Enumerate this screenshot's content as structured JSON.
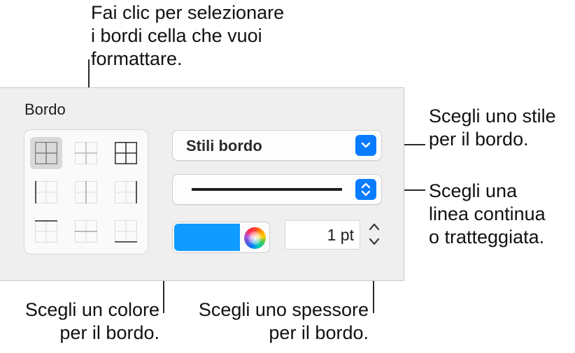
{
  "callouts": {
    "select_borders": [
      "Fai clic per selezionare",
      "i bordi cella che vuoi",
      "formattare."
    ],
    "border_style": [
      "Scegli uno stile",
      "per il bordo."
    ],
    "line_type": [
      "Scegli una",
      "linea continua",
      "o tratteggiata."
    ],
    "color": [
      "Scegli un colore",
      "per il bordo."
    ],
    "thickness": [
      "Scegli uno spessore",
      "per il bordo."
    ]
  },
  "panel": {
    "title": "Bordo",
    "border_cells": [
      "all-borders",
      "inner-borders",
      "outer-borders",
      "left-border",
      "inner-vertical-borders",
      "right-border",
      "top-border",
      "inner-horizontal-borders",
      "bottom-border"
    ],
    "selected_border_cell": "all-borders",
    "style_popup": {
      "label": "Stili bordo"
    },
    "line_popup": {
      "value": "solid"
    },
    "color": {
      "swatch_hex": "#0f9bff"
    },
    "width": {
      "value": "1 pt"
    }
  },
  "colors": {
    "accent": "#0a7cff",
    "panel_bg": "#efefef"
  }
}
